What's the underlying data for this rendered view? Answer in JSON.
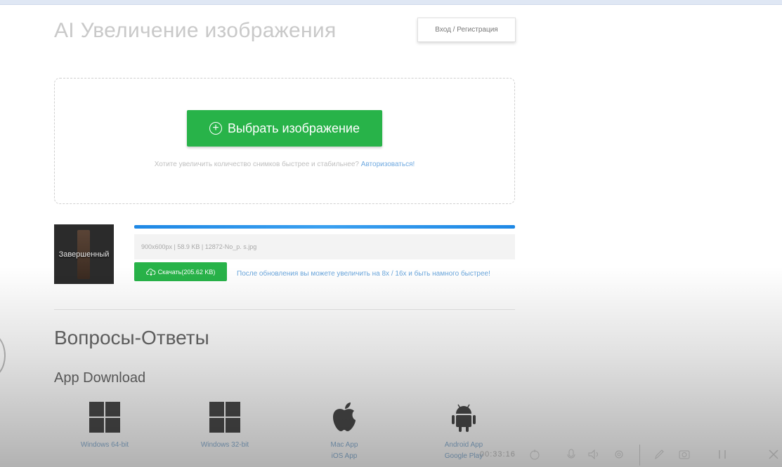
{
  "header": {
    "title": "AI Увеличение изображения",
    "login_label": "Вход / Регистрация"
  },
  "upload": {
    "choose_label": "Выбрать изображение",
    "hint_text": "Хотите увеличить количество снимков быстрее и стабильнее?",
    "hint_link": "Авторизоваться!"
  },
  "result": {
    "thumb_label": "Завершенный",
    "progress": 1.0,
    "file_info": "900x600px | 58.9 KB | 12872-No_p. s.jpg",
    "download_label": "Скачать(205.62 KB)",
    "upgrade_note": "После обновления вы можете увеличить на 8x / 16x и быть намного быстрее!"
  },
  "faq": {
    "title": "Вопросы-Ответы"
  },
  "apps": {
    "title": "App Download",
    "items": [
      {
        "label": "Windows 64-bit",
        "sub": "",
        "icon": "windows-icon"
      },
      {
        "label": "Windows 32-bit",
        "sub": "",
        "icon": "windows-icon"
      },
      {
        "label": "Mac App",
        "sub": "iOS App",
        "icon": "apple-icon"
      },
      {
        "label": "Android App",
        "sub": "Google Play",
        "icon": "android-icon"
      }
    ]
  },
  "media_bar": {
    "time": "00:33:16"
  },
  "colors": {
    "green": "#28b349",
    "blue": "#1e88e5",
    "link": "#6aa6dc"
  }
}
